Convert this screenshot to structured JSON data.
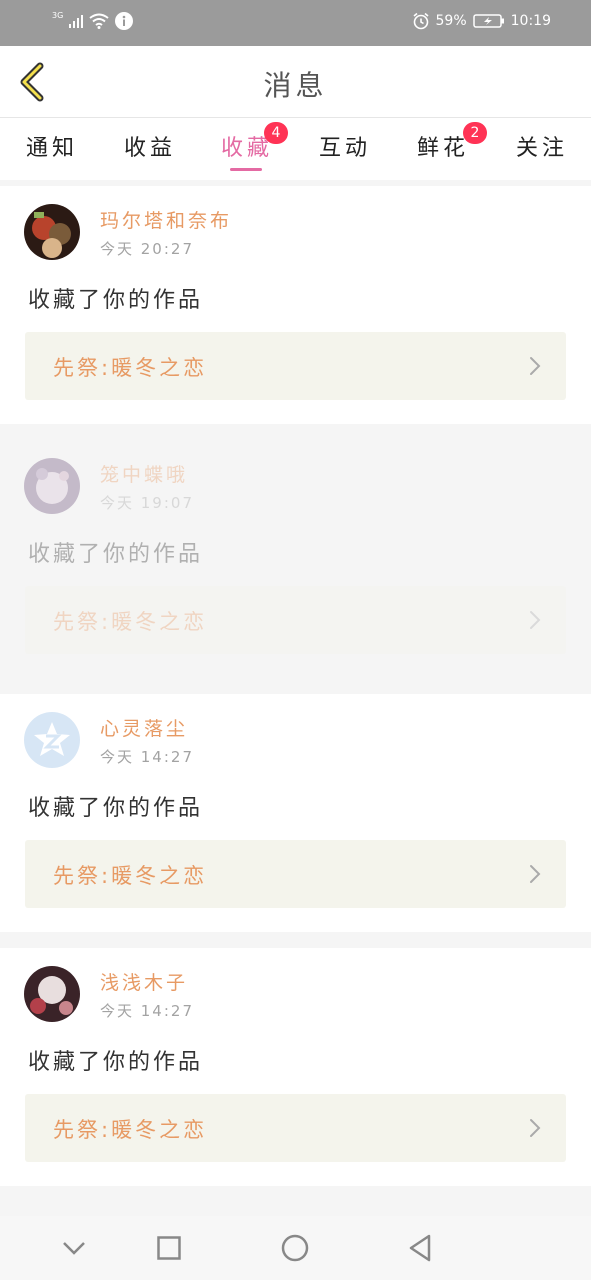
{
  "status_bar": {
    "network": "3G",
    "battery": "59%",
    "time": "10:19"
  },
  "header": {
    "title": "消息",
    "back_icon": "chevron-left-icon"
  },
  "tabs": [
    {
      "label": "通知",
      "badge": null,
      "active": false
    },
    {
      "label": "收益",
      "badge": null,
      "active": false
    },
    {
      "label": "收藏",
      "badge": "4",
      "active": true
    },
    {
      "label": "互动",
      "badge": null,
      "active": false
    },
    {
      "label": "鲜花",
      "badge": "2",
      "active": false
    },
    {
      "label": "关注",
      "badge": null,
      "active": false
    }
  ],
  "messages": [
    {
      "user": "玛尔塔和奈布",
      "time": "今天  20:27",
      "text": "收藏了你的作品",
      "work": "先祭:暖冬之恋",
      "faded": false
    },
    {
      "user": "笼中蝶哦",
      "time": "今天  19:07",
      "text": "收藏了你的作品",
      "work": "先祭:暖冬之恋",
      "faded": true
    },
    {
      "user": "心灵落尘",
      "time": "今天  14:27",
      "text": "收藏了你的作品",
      "work": "先祭:暖冬之恋",
      "faded": false
    },
    {
      "user": "浅浅木子",
      "time": "今天  14:27",
      "text": "收藏了你的作品",
      "work": "先祭:暖冬之恋",
      "faded": false
    }
  ],
  "colors": {
    "accent": "#e46aa3",
    "name_color": "#e79a64",
    "badge": "#ff3355",
    "status_bar": "#9b9b9b"
  },
  "nav_bar": {
    "icons": [
      "chevron-down-icon",
      "square-icon",
      "circle-icon",
      "triangle-back-icon"
    ]
  }
}
